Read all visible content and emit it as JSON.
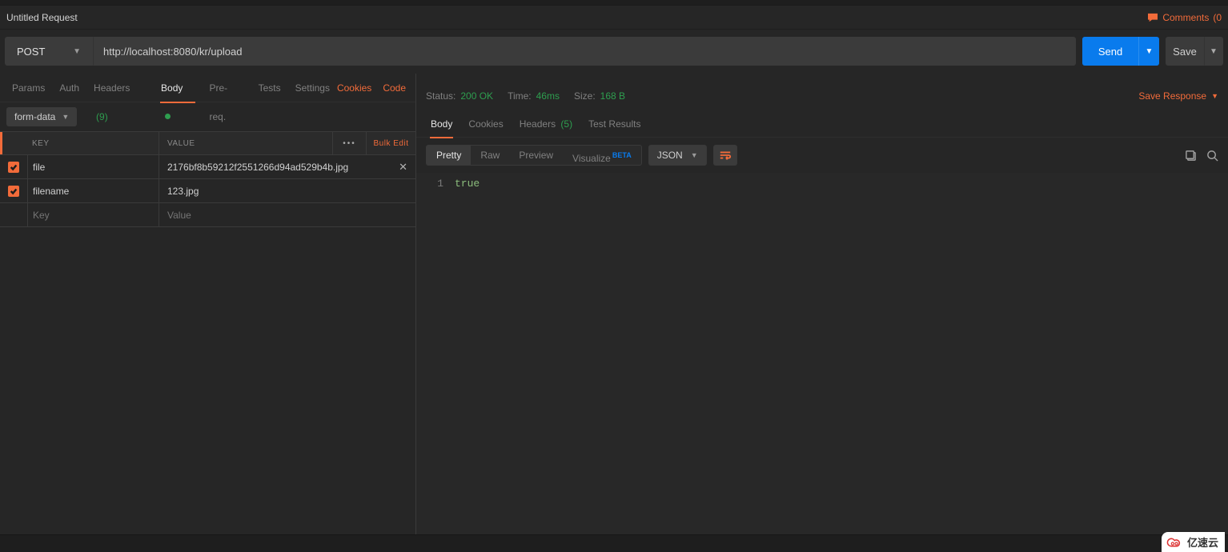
{
  "title": "Untitled Request",
  "comments": {
    "label": "Comments",
    "count": "(0"
  },
  "request": {
    "method": "POST",
    "url": "http://localhost:8080/kr/upload",
    "send": "Send",
    "save": "Save"
  },
  "reqTabs": {
    "params": "Params",
    "auth": "Auth",
    "headers": "Headers",
    "headersCount": "(9)",
    "body": "Body",
    "prereq": "Pre-req.",
    "tests": "Tests",
    "settings": "Settings",
    "cookies": "Cookies",
    "code": "Code"
  },
  "bodyType": "form-data",
  "kv": {
    "keyHeader": "KEY",
    "valueHeader": "VALUE",
    "actions": "•••",
    "bulkEdit": "Bulk Edit",
    "rows": [
      {
        "key": "file",
        "value": "2176bf8b59212f2551266d94ad529b4b.jpg",
        "hasClear": true
      },
      {
        "key": "filename",
        "value": "123.jpg",
        "hasClear": false
      }
    ],
    "placeholderKey": "Key",
    "placeholderValue": "Value"
  },
  "response": {
    "statusLabel": "Status:",
    "statusValue": "200 OK",
    "timeLabel": "Time:",
    "timeValue": "46ms",
    "sizeLabel": "Size:",
    "sizeValue": "168 B",
    "saveResponse": "Save Response"
  },
  "respTabs": {
    "body": "Body",
    "cookies": "Cookies",
    "headers": "Headers",
    "headersCount": "(5)",
    "testResults": "Test Results"
  },
  "viewTabs": {
    "pretty": "Pretty",
    "raw": "Raw",
    "preview": "Preview",
    "visualize": "Visualize",
    "beta": "BETA"
  },
  "langSelect": "JSON",
  "responseBody": {
    "lineNumber": "1",
    "content": "true"
  },
  "watermark": "亿速云"
}
